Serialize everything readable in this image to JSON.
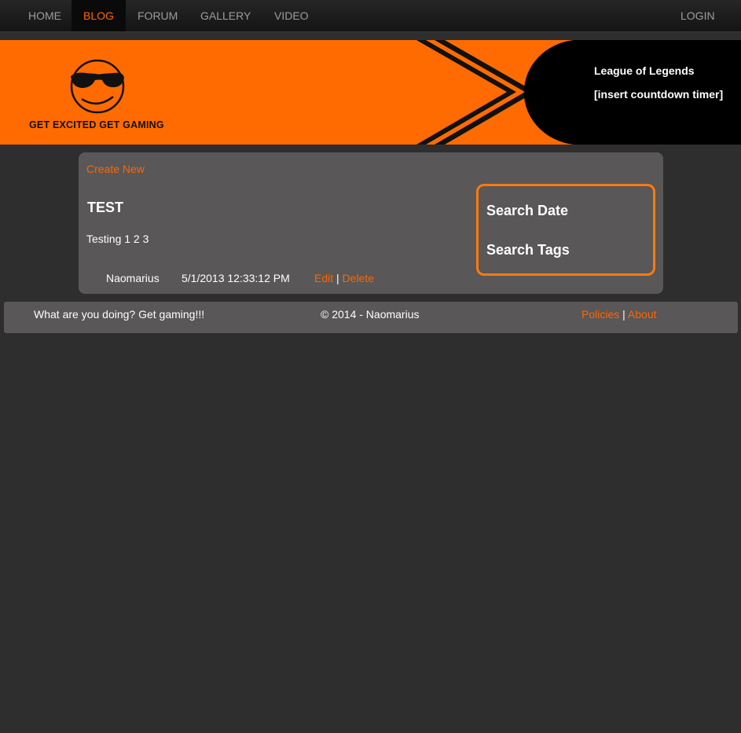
{
  "nav": {
    "items": [
      {
        "label": "HOME"
      },
      {
        "label": "BLOG"
      },
      {
        "label": "FORUM"
      },
      {
        "label": "GALLERY"
      },
      {
        "label": "VIDEO"
      }
    ],
    "login": "LOGIN"
  },
  "banner": {
    "tagline": "GET EXCITED GET GAMING",
    "title": "League of Legends",
    "timer": "[insert countdown timer]"
  },
  "main": {
    "create_new": "Create New",
    "post": {
      "title": "TEST",
      "body": "Testing 1 2 3",
      "author": "Naomarius",
      "date": "5/1/2013 12:33:12 PM",
      "edit": "Edit",
      "separator": "|",
      "delete": "Delete"
    },
    "search": {
      "date": "Search Date",
      "tags": "Search Tags"
    }
  },
  "footer": {
    "left": "What are you doing? Get gaming!!!",
    "center": "© 2014 - Naomarius",
    "policies": "Policies",
    "separator": "|",
    "about": "About"
  },
  "colors": {
    "accent": "#ff6600",
    "banner": "#ff6b00",
    "background": "#2e2e2e",
    "panel": "#595757"
  },
  "icons": {
    "logo": "sunglasses-smiley-icon",
    "chevron": "chevron-right-stripes-icon"
  }
}
